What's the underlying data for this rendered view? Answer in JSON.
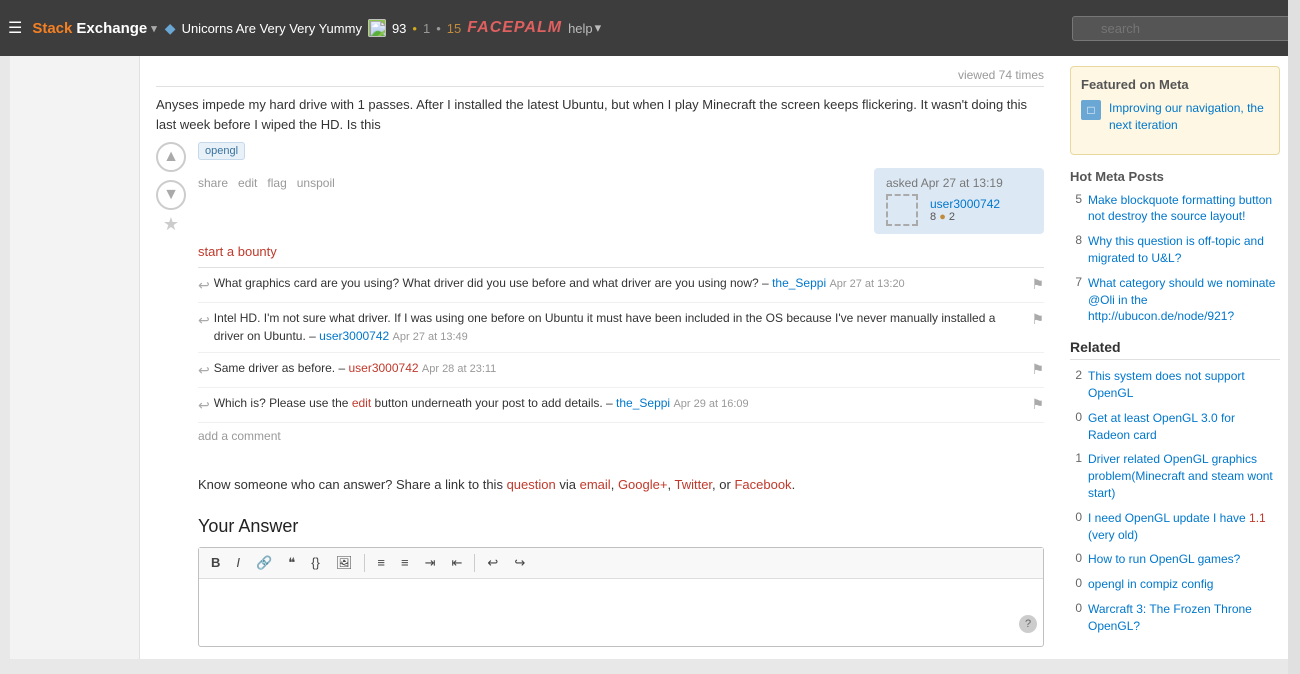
{
  "topbar": {
    "hamburger": "☰",
    "logo_stack": "Stack",
    "logo_exchange": "Exchange",
    "dropdown_arrow": "▾",
    "inbox_icon": "✉",
    "achievements_icon": "📊",
    "site_name": "Unicorns Are Very Very Yummy",
    "site_diamond": "◆",
    "rep_score": "93",
    "dot_gold": "•",
    "dot_silver": "•",
    "silver_count": "1",
    "dot_bronze": "•",
    "bronze_count": "15",
    "facepalm_text": "FACEPALM",
    "help_label": "help",
    "help_dropdown": "▾",
    "search_placeholder": "search"
  },
  "viewed": {
    "text": "viewed 74 times"
  },
  "post": {
    "body_text": "Anyses impede my hard drive with 1 passes. After I installed the latest Ubuntu, but when I play Minecraft the screen keeps flickering. It wasn't doing this last week before I wiped the HD. Is this",
    "tag": "opengl",
    "actions": {
      "share": "share",
      "edit": "edit",
      "flag": "flag",
      "unspoil": "unspoil"
    },
    "asked_label": "asked Apr 27 at 13:19",
    "user_name": "user3000742",
    "user_rep": "8",
    "user_bronze": "2",
    "bounty": "start a bounty"
  },
  "comments": [
    {
      "id": 1,
      "text": "What graphics card are you using? What driver did you use before and what driver are you using now? –",
      "user": "the_Seppi",
      "timestamp": "Apr 27 at 13:20"
    },
    {
      "id": 2,
      "text": "Intel HD. I'm not sure what driver. If I was using one before on Ubuntu it must have been included in the OS because I've never manually installed a driver on Ubuntu. –",
      "user": "user3000742",
      "timestamp": "Apr 27 at 13:49"
    },
    {
      "id": 3,
      "text": "Same driver as before. –",
      "user": "user3000742",
      "timestamp": "Apr 28 at 23:11"
    },
    {
      "id": 4,
      "text": "Which is? Please use the",
      "edit_word": "edit",
      "text_after": "button underneath your post to add details. –",
      "user": "the_Seppi",
      "timestamp": "Apr 29 at 16:09"
    }
  ],
  "add_comment": "add a comment",
  "share_section": {
    "intro": "Know someone who can answer? Share a link to this",
    "question_link": "question",
    "via_text": "via",
    "email_link": "email",
    "comma1": ",",
    "googleplus_link": "Google+",
    "comma2": ",",
    "twitter_link": "Twitter",
    "comma3": ",",
    "or_text": "or",
    "facebook_link": "Facebook",
    "period": "."
  },
  "your_answer": {
    "heading": "Your Answer",
    "toolbar": {
      "bold": "B",
      "italic": "I",
      "link": "🔗",
      "blockquote": "❝",
      "code": "{}",
      "image": "🖼",
      "ordered_list": "≡",
      "unordered_list": "≡",
      "indent": "⇥",
      "outdent": "⇤",
      "undo": "↩",
      "redo": "↪",
      "help": "?"
    }
  },
  "right_sidebar": {
    "featured_meta": {
      "heading": "Featured on Meta",
      "items": [
        {
          "id": 1,
          "text": "Improving our navigation, the next iteration",
          "icon": "square"
        }
      ]
    },
    "hot_meta_posts": {
      "heading": "Hot Meta Posts",
      "items": [
        {
          "count": "5",
          "text": "Make blockquote formatting button not destroy the source layout!"
        },
        {
          "count": "8",
          "text": "Why this question is off-topic and migrated to U&L?"
        },
        {
          "count": "7",
          "text": "What category should we nominate @Oli in the http://ubucon.de/node/921?"
        }
      ]
    },
    "related": {
      "heading": "Related",
      "items": [
        {
          "vote": "2",
          "text": "This system does not support OpenGL"
        },
        {
          "vote": "0",
          "text": "Get at least OpenGL 3.0 for Radeon card"
        },
        {
          "vote": "1",
          "text": "Driver related OpenGL graphics problem(Minecraft and steam wont start)"
        },
        {
          "vote": "0",
          "text": "I need OpenGL update I have 1.1 (very old)"
        },
        {
          "vote": "0",
          "text": "How to run OpenGL games?"
        },
        {
          "vote": "0",
          "text": "opengl in compiz config"
        },
        {
          "vote": "0",
          "text": "Warcraft 3: The Frozen Throne OpenGL?"
        }
      ]
    }
  }
}
